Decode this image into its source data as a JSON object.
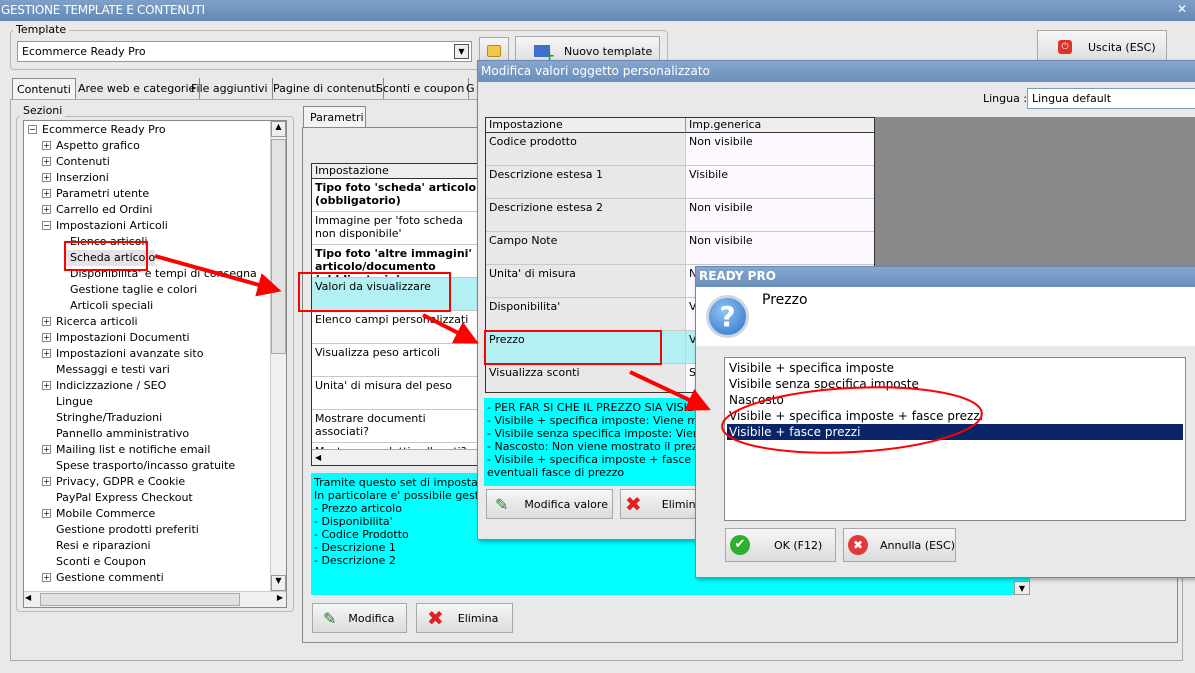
{
  "window": {
    "title": "GESTIONE TEMPLATE E CONTENUTI",
    "close": "✕"
  },
  "template": {
    "label": "Template",
    "value": "Ecommerce Ready Pro",
    "new_button": "Nuovo template",
    "exit_button": "Uscita (ESC)"
  },
  "tabs": [
    "Contenuti",
    "Aree web e categorie",
    "File aggiuntivi",
    "Pagine di contenuti",
    "Sconti e coupon",
    "G"
  ],
  "sections": {
    "label": "Sezioni",
    "root": "Ecommerce Ready Pro",
    "items": [
      {
        "label": "Aspetto grafico",
        "exp": "+",
        "lvl": 1
      },
      {
        "label": "Contenuti",
        "exp": "+",
        "lvl": 1
      },
      {
        "label": "Inserzioni",
        "exp": "+",
        "lvl": 1
      },
      {
        "label": "Parametri utente",
        "exp": "+",
        "lvl": 1
      },
      {
        "label": "Carrello ed Ordini",
        "exp": "+",
        "lvl": 1
      },
      {
        "label": "Impostazioni Articoli",
        "exp": "−",
        "lvl": 1
      },
      {
        "label": "Elenco articoli",
        "exp": "",
        "lvl": 2
      },
      {
        "label": "Scheda articolo",
        "exp": "",
        "lvl": 2
      },
      {
        "label": "Disponibilita' e tempi di consegna",
        "exp": "",
        "lvl": 2
      },
      {
        "label": "Gestione taglie e colori",
        "exp": "",
        "lvl": 2
      },
      {
        "label": "Articoli speciali",
        "exp": "",
        "lvl": 2
      },
      {
        "label": "Ricerca articoli",
        "exp": "+",
        "lvl": 1
      },
      {
        "label": "Impostazioni Documenti",
        "exp": "+",
        "lvl": 1
      },
      {
        "label": "Impostazioni avanzate sito",
        "exp": "+",
        "lvl": 1
      },
      {
        "label": "Messaggi e testi vari",
        "exp": "",
        "lvl": 1
      },
      {
        "label": "Indicizzazione / SEO",
        "exp": "+",
        "lvl": 1
      },
      {
        "label": "Lingue",
        "exp": "",
        "lvl": 1
      },
      {
        "label": "Stringhe/Traduzioni",
        "exp": "",
        "lvl": 1
      },
      {
        "label": "Pannello amministrativo",
        "exp": "",
        "lvl": 1
      },
      {
        "label": "Mailing list e notifiche email",
        "exp": "+",
        "lvl": 1
      },
      {
        "label": "Spese trasporto/incasso gratuite",
        "exp": "",
        "lvl": 1
      },
      {
        "label": "Privacy, GDPR e Cookie",
        "exp": "+",
        "lvl": 1
      },
      {
        "label": "PayPal Express Checkout",
        "exp": "",
        "lvl": 1
      },
      {
        "label": "Mobile Commerce",
        "exp": "+",
        "lvl": 1
      },
      {
        "label": "Gestione prodotti preferiti",
        "exp": "",
        "lvl": 1
      },
      {
        "label": "Resi e riparazioni",
        "exp": "",
        "lvl": 1
      },
      {
        "label": "Sconti e Coupon",
        "exp": "",
        "lvl": 1
      },
      {
        "label": "Gestione commenti",
        "exp": "+",
        "lvl": 1
      }
    ]
  },
  "params": {
    "tab": "Parametri",
    "header": "Impostazione",
    "rows": [
      {
        "text": "Tipo foto 'scheda' articolo (obbligatorio)",
        "bold": true
      },
      {
        "text": "Immagine per 'foto scheda non disponibile'",
        "bold": false
      },
      {
        "text": "Tipo foto 'altre immagini' articolo/documento (obbligatorio)",
        "bold": true
      },
      {
        "text": "Valori da visualizzare",
        "bold": false
      },
      {
        "text": "Elenco campi personalizzati",
        "bold": false
      },
      {
        "text": "Visualizza peso articoli",
        "bold": false
      },
      {
        "text": "Unita' di misura del peso",
        "bold": false
      },
      {
        "text": "Mostrare documenti associati?",
        "bold": false
      },
      {
        "text": "Mostrare prodotti collegati?",
        "bold": false
      }
    ],
    "help": [
      "Tramite questo set di impostazioni e' possibile ...",
      "In particolare e' possibile gestire la visualizzazione di:",
      "- Prezzo articolo",
      "- Disponibilita'",
      "- Codice Prodotto",
      "- Descrizione 1",
      "- Descrizione 2"
    ],
    "edit_button": "Modifica",
    "delete_button": "Elimina"
  },
  "modify_dialog": {
    "title": "Modifica valori oggetto personalizzato",
    "lingua_label": "Lingua :",
    "lingua_value": "Lingua default",
    "col1": "Impostazione",
    "col2": "Imp.generica",
    "rows": [
      [
        "Codice prodotto",
        "Non visibile"
      ],
      [
        "Descrizione estesa 1",
        "Visibile"
      ],
      [
        "Descrizione estesa 2",
        "Non visibile"
      ],
      [
        "Campo Note",
        "Non visibile"
      ],
      [
        "Unita' di misura",
        "N"
      ],
      [
        "Disponibilita'",
        "V"
      ],
      [
        "Prezzo",
        "V p"
      ],
      [
        "Visualizza sconti",
        "S"
      ]
    ],
    "help": [
      "- PER FAR SI CHE IL PREZZO SIA VISIBILE",
      "- Visibile + specifica imposte: Viene mostrato",
      "- Visibile senza specifica imposte: Viene mostrato",
      "- Nascosto: Non viene mostrato il prezzo",
      "- Visibile + specifica imposte + fasce prezzi:",
      "eventuali fasce di prezzo"
    ],
    "edit_button": "Modifica valore",
    "delete_button": "Elimina"
  },
  "choice_dialog": {
    "title": "READY PRO",
    "question": "Prezzo",
    "options": [
      "Visibile + specifica imposte",
      "Visibile senza specifica imposte",
      "Nascosto",
      "Visibile + specifica imposte + fasce prezzi",
      "Visibile + fasce prezzi"
    ],
    "selected_index": 4,
    "ok": "OK (F12)",
    "cancel": "Annulla (ESC)"
  },
  "colors": {
    "titlebar": "#6a8fbd",
    "highlight": "#b3f0f4",
    "help_bg": "#00ffff",
    "selection": "#0a246a",
    "annotation": "#ff0000"
  }
}
